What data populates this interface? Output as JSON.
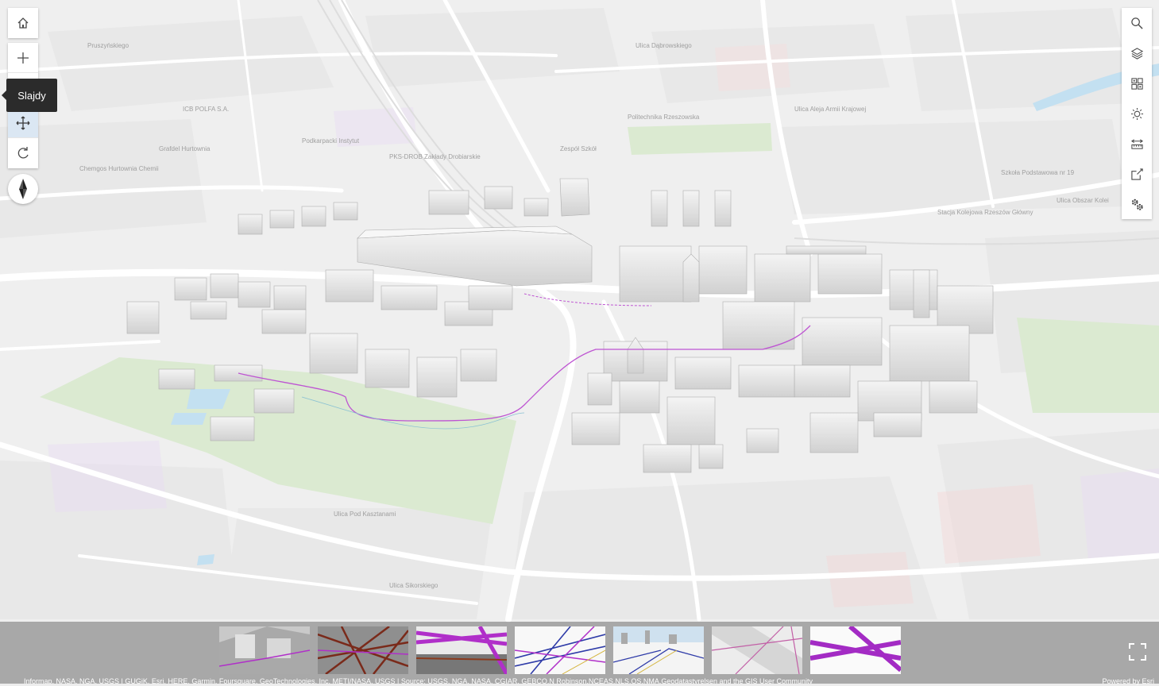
{
  "tooltip": {
    "text": "Slajdy"
  },
  "left_tools": [
    {
      "name": "home-button",
      "icon": "home-icon"
    },
    {
      "name": "zoom-in-button",
      "icon": "plus-icon"
    },
    {
      "name": "zoom-out-button",
      "icon": "minus-icon"
    },
    {
      "name": "pan-button",
      "icon": "move-icon"
    },
    {
      "name": "rotate-button",
      "icon": "rotate-icon"
    }
  ],
  "right_tools": [
    {
      "name": "search-button",
      "icon": "search-icon"
    },
    {
      "name": "layers-button",
      "icon": "layers-icon"
    },
    {
      "name": "basemap-gallery-button",
      "icon": "grid-icon"
    },
    {
      "name": "daylight-button",
      "icon": "sun-icon"
    },
    {
      "name": "measure-button",
      "icon": "ruler-icon"
    },
    {
      "name": "share-button",
      "icon": "share-icon"
    },
    {
      "name": "settings-button",
      "icon": "gears-icon"
    }
  ],
  "map_labels": [
    "Pruszyńskiego",
    "ICB POLFA S.A.",
    "Grafdel Hurtownia",
    "Politechnika Rzeszowska",
    "Zespół Szkół",
    "Ulica Aleja Armii Krajowej",
    "Stacja Kolejowa Rzeszów Główny",
    "Szkoła Podstawowa nr 19",
    "Ulica Obszar Kolei",
    "Chemgos Hurtownia Chemii",
    "PKS-DROB Zakłady Drobiarskie",
    "Ulica Pod Kasztanami",
    "Ulica Dąbrowskiego",
    "Podkarpacki Instytut",
    "Ulica Sikorskiego"
  ],
  "slides": [
    {
      "name": "slide-1",
      "theme": "buildings-gray"
    },
    {
      "name": "slide-2",
      "theme": "pipes-brown"
    },
    {
      "name": "slide-3",
      "theme": "pipes-magenta"
    },
    {
      "name": "slide-4",
      "theme": "lines-blue"
    },
    {
      "name": "slide-5",
      "theme": "city-sky"
    },
    {
      "name": "slide-6",
      "theme": "lines-pink"
    },
    {
      "name": "slide-7",
      "theme": "pipes-purple"
    }
  ],
  "attribution": "Informap, NASA, NGA, USGS | GUGiK, Esri, HERE, Garmin, Foursquare, GeoTechnologies, Inc, METI/NASA, USGS | Source: USGS, NGA, NASA, CGIAR, GEBCO,N Robinson,NCEAS,NLS,OS,NMA,Geodatastyrelsen and the GIS User Community",
  "powered": "Powered by Esri",
  "colors": {
    "magenta_pipe": "#b02fc9",
    "park": "#cfe4c2",
    "water": "#a9d4ec",
    "background": "#ededed"
  }
}
